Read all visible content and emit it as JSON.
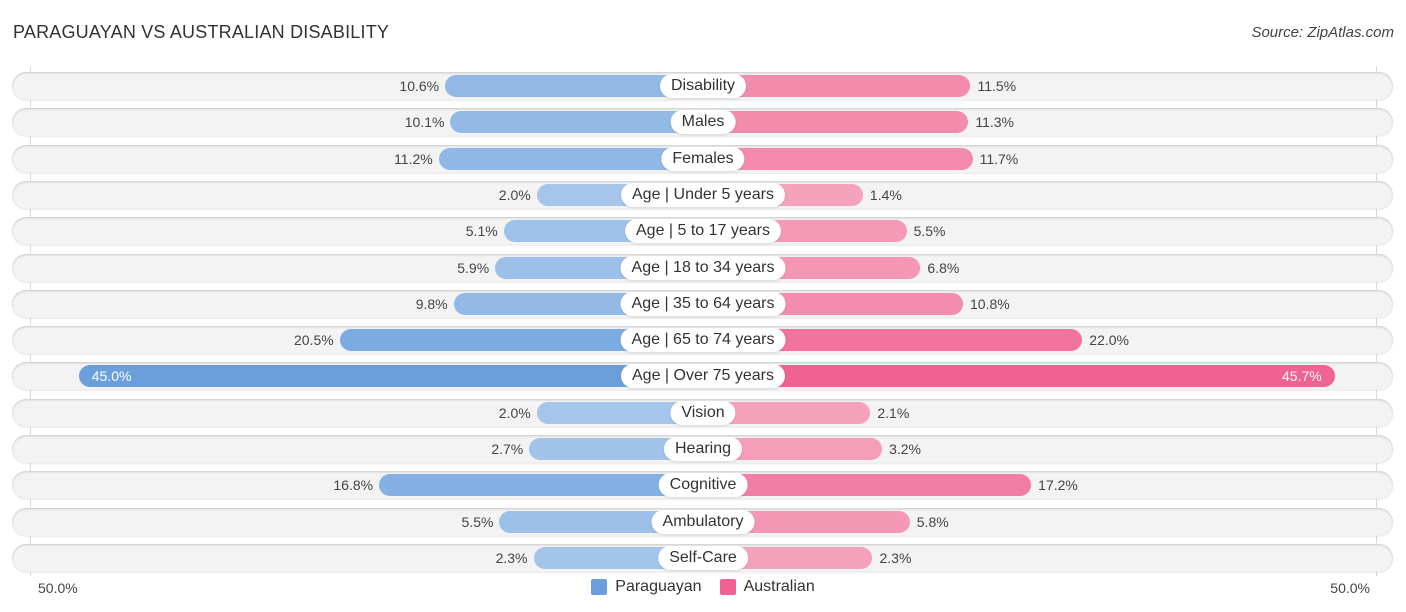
{
  "header": {
    "title": "PARAGUAYAN VS AUSTRALIAN DISABILITY",
    "source": "Source: ZipAtlas.com"
  },
  "colors": {
    "paraguayan": "#6a9fdc",
    "paraguayan_light": "#a9c8ec",
    "australian": "#f06292",
    "australian_light": "#f5a6bf"
  },
  "chart_data": {
    "type": "bar",
    "orientation": "horizontal-diverging",
    "title": "PARAGUAYAN VS AUSTRALIAN DISABILITY",
    "categories": [
      "Disability",
      "Males",
      "Females",
      "Age | Under 5 years",
      "Age | 5 to 17 years",
      "Age | 18 to 34 years",
      "Age | 35 to 64 years",
      "Age | 65 to 74 years",
      "Age | Over 75 years",
      "Vision",
      "Hearing",
      "Cognitive",
      "Ambulatory",
      "Self-Care"
    ],
    "series": [
      {
        "name": "Paraguayan",
        "values": [
          10.6,
          10.1,
          11.2,
          2.0,
          5.1,
          5.9,
          9.8,
          20.5,
          45.0,
          2.0,
          2.7,
          16.8,
          5.5,
          2.3
        ],
        "labels": [
          "10.6%",
          "10.1%",
          "11.2%",
          "2.0%",
          "5.1%",
          "5.9%",
          "9.8%",
          "20.5%",
          "45.0%",
          "2.0%",
          "2.7%",
          "16.8%",
          "5.5%",
          "2.3%"
        ]
      },
      {
        "name": "Australian",
        "values": [
          11.5,
          11.3,
          11.7,
          1.4,
          5.5,
          6.8,
          10.8,
          22.0,
          45.7,
          2.1,
          3.2,
          17.2,
          5.8,
          2.3
        ],
        "labels": [
          "11.5%",
          "11.3%",
          "11.7%",
          "1.4%",
          "5.5%",
          "6.8%",
          "10.8%",
          "22.0%",
          "45.7%",
          "2.1%",
          "3.2%",
          "17.2%",
          "5.8%",
          "2.3%"
        ]
      }
    ],
    "xlim": [
      -50,
      50
    ],
    "axis_labels": {
      "left": "50.0%",
      "right": "50.0%"
    },
    "legend": {
      "position": "bottom-center",
      "entries": [
        "Paraguayan",
        "Australian"
      ]
    },
    "grid": false
  }
}
